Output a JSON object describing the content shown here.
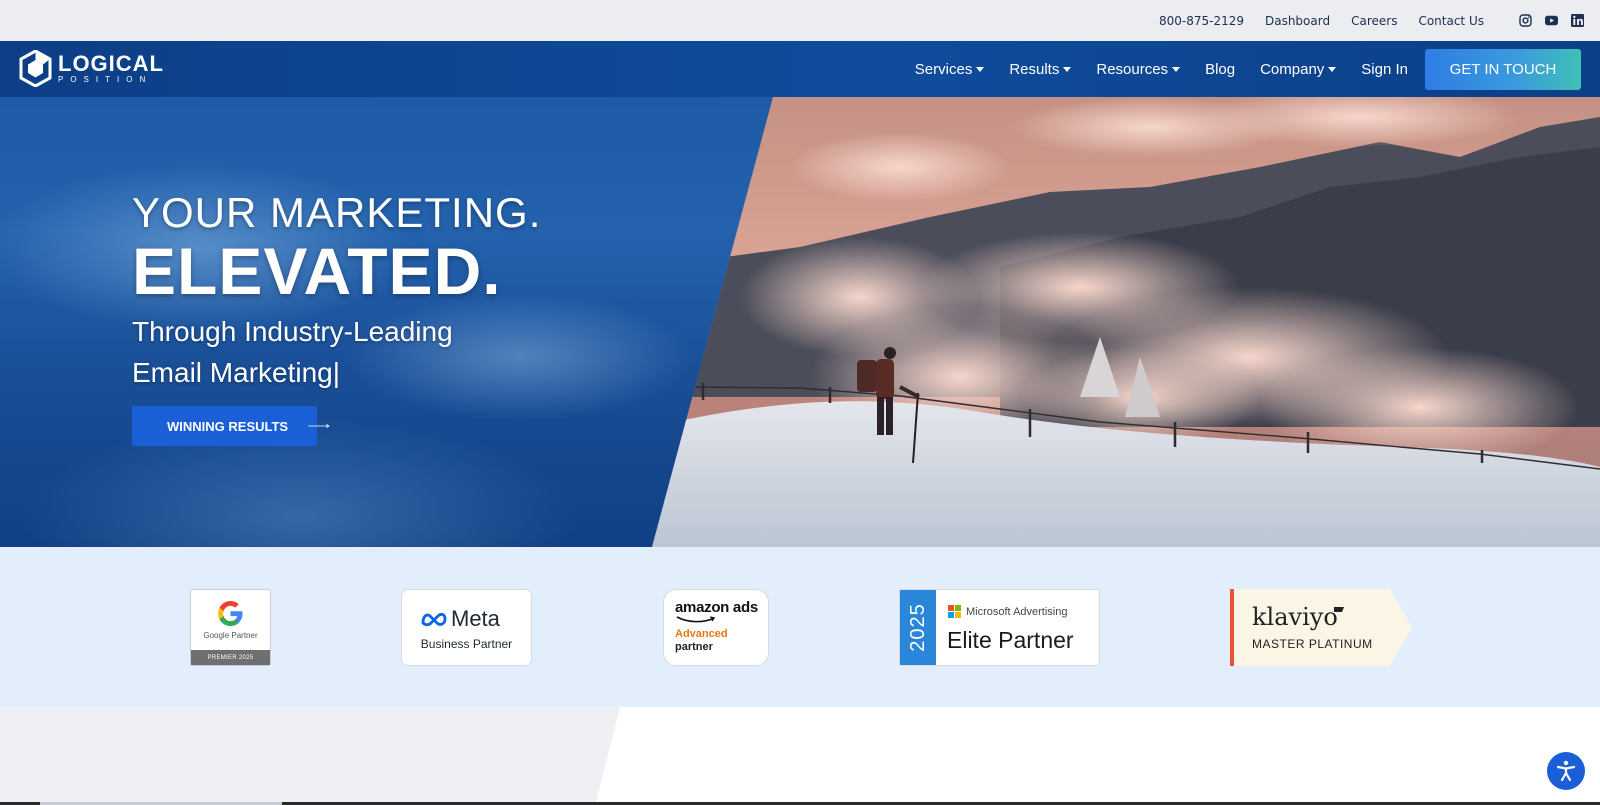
{
  "topbar": {
    "phone": "800-875-2129",
    "links": [
      "Dashboard",
      "Careers",
      "Contact Us"
    ],
    "social": [
      "instagram-icon",
      "youtube-icon",
      "linkedin-icon"
    ]
  },
  "logo": {
    "line1": "LOGICAL",
    "line2": "POSITION"
  },
  "nav": {
    "items": [
      {
        "label": "Services",
        "dropdown": true
      },
      {
        "label": "Results",
        "dropdown": true
      },
      {
        "label": "Resources",
        "dropdown": true
      },
      {
        "label": "Blog",
        "dropdown": false
      },
      {
        "label": "Company",
        "dropdown": true
      },
      {
        "label": "Sign In",
        "dropdown": false
      }
    ],
    "cta": "GET IN TOUCH"
  },
  "hero": {
    "line1": "YOUR MARKETING.",
    "line2": "ELEVATED.",
    "line3a": "Through Industry-Leading",
    "line3b": "Email Marketing",
    "cursor": "|",
    "button": "WINNING RESULTS"
  },
  "partners": {
    "google": {
      "name": "Google Partner",
      "tier": "PREMIER 2025"
    },
    "meta": {
      "wordmark": "Meta",
      "subtitle": "Business Partner"
    },
    "amazon": {
      "wordmark": "amazon ads",
      "tier1": "Advanced",
      "tier2": "partner"
    },
    "microsoft": {
      "year": "2025",
      "name": "Microsoft Advertising",
      "tier": "Elite Partner"
    },
    "klaviyo": {
      "wordmark": "klaviyo",
      "tier": "MASTER PLATINUM"
    }
  },
  "colors": {
    "nav": "#0f4c9c",
    "cta_start": "#2f7de6",
    "cta_end": "#3fc0b6",
    "partner_strip": "#e2eefc",
    "accent": "#1a5fd6"
  }
}
